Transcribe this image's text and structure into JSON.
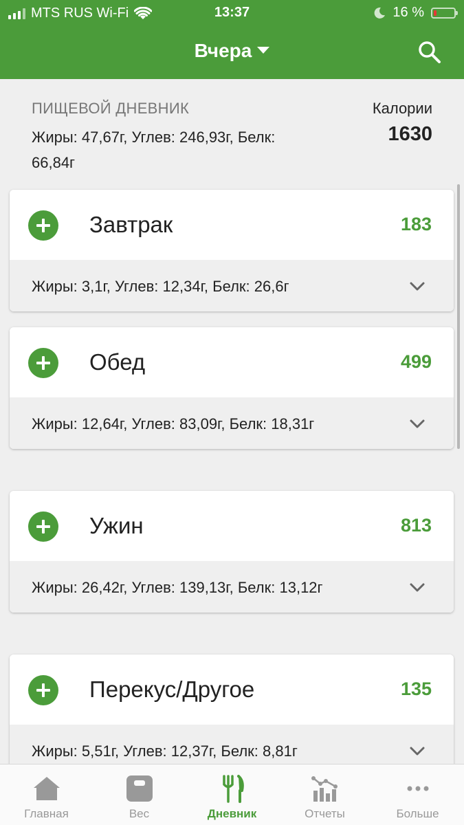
{
  "status": {
    "carrier": "MTS RUS Wi-Fi",
    "time": "13:37",
    "battery": "16 %",
    "battery_level": 0.16,
    "icons": [
      "signal-icon",
      "wifi-icon",
      "moon-icon",
      "battery-icon"
    ]
  },
  "nav": {
    "title": "Вчера",
    "search_icon": "search-icon"
  },
  "summary": {
    "label": "ПИЩЕВОЙ ДНЕВНИК",
    "macros": "Жиры: 47,67г, Углев: 246,93г, Белк: 66,84г",
    "calories_label": "Калории",
    "calories_value": "1630"
  },
  "meals": [
    {
      "name": "Завтрак",
      "kcal": "183",
      "macros": "Жиры: 3,1г, Углев: 12,34г, Белк: 26,6г"
    },
    {
      "name": "Обед",
      "kcal": "499",
      "macros": "Жиры: 12,64г, Углев: 83,09г, Белк: 18,31г"
    },
    {
      "name": "Ужин",
      "kcal": "813",
      "macros": "Жиры: 26,42г, Углев: 139,13г, Белк: 13,12г"
    },
    {
      "name": "Перекус/Другое",
      "kcal": "135",
      "macros": "Жиры: 5,51г, Углев: 12,37г, Белк: 8,81г"
    }
  ],
  "tabs": [
    {
      "label": "Главная",
      "icon": "home-icon"
    },
    {
      "label": "Вес",
      "icon": "scale-icon"
    },
    {
      "label": "Дневник",
      "icon": "fork-knife-icon",
      "active": true
    },
    {
      "label": "Отчеты",
      "icon": "chart-icon"
    },
    {
      "label": "Больше",
      "icon": "more-icon"
    }
  ],
  "colors": {
    "brand_green": "#4b9c3a",
    "background": "#efefef",
    "battery_low": "#e53935"
  }
}
